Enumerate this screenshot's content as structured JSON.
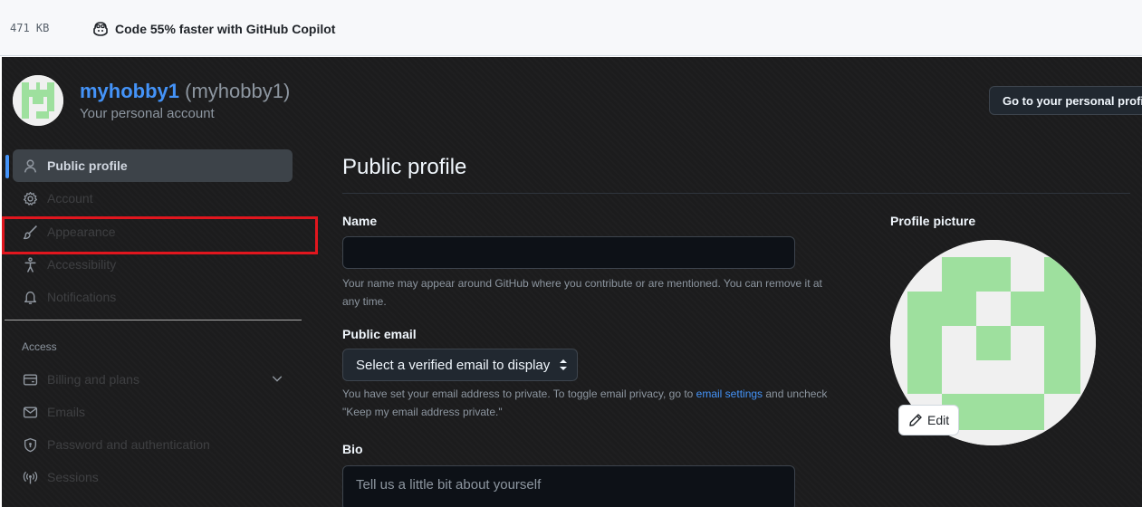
{
  "topbar": {
    "file_size": "471 KB",
    "promo_text": "Code 55% faster with GitHub Copilot",
    "promo_icon": "copilot-icon"
  },
  "account": {
    "login": "myhobby1",
    "login_paren": "(myhobby1)",
    "subtitle": "Your personal account",
    "goto_button": "Go to your personal profile"
  },
  "sidebar": {
    "items": [
      {
        "label": "Public profile",
        "icon": "person-icon",
        "active": true
      },
      {
        "label": "Account",
        "icon": "gear-icon",
        "active": false
      },
      {
        "label": "Appearance",
        "icon": "paintbrush-icon",
        "active": false
      },
      {
        "label": "Accessibility",
        "icon": "accessibility-icon",
        "active": false
      },
      {
        "label": "Notifications",
        "icon": "bell-icon",
        "active": false
      }
    ],
    "access_heading": "Access",
    "access_items": [
      {
        "label": "Billing and plans",
        "icon": "credit-card-icon"
      },
      {
        "label": "Emails",
        "icon": "mail-icon"
      },
      {
        "label": "Password and authentication",
        "icon": "shield-lock-icon"
      },
      {
        "label": "Sessions",
        "icon": "broadcast-icon"
      }
    ]
  },
  "main": {
    "title": "Public profile",
    "name_label": "Name",
    "name_value": "",
    "name_help": "Your name may appear around GitHub where you contribute or are mentioned. You can remove it at any time.",
    "email_label": "Public email",
    "email_select": "Select a verified email to display",
    "email_help_before": "You have set your email address to private. To toggle email privacy, go to ",
    "email_help_link": "email settings",
    "email_help_after": " and uncheck \"Keep my email address private.\"",
    "bio_label": "Bio",
    "bio_placeholder": "Tell us a little bit about yourself",
    "profile_picture_label": "Profile picture",
    "edit_button": "Edit"
  },
  "colors": {
    "accent": "#4493f8",
    "highlight": "#e1161e",
    "identicon": "#9ee09e"
  }
}
